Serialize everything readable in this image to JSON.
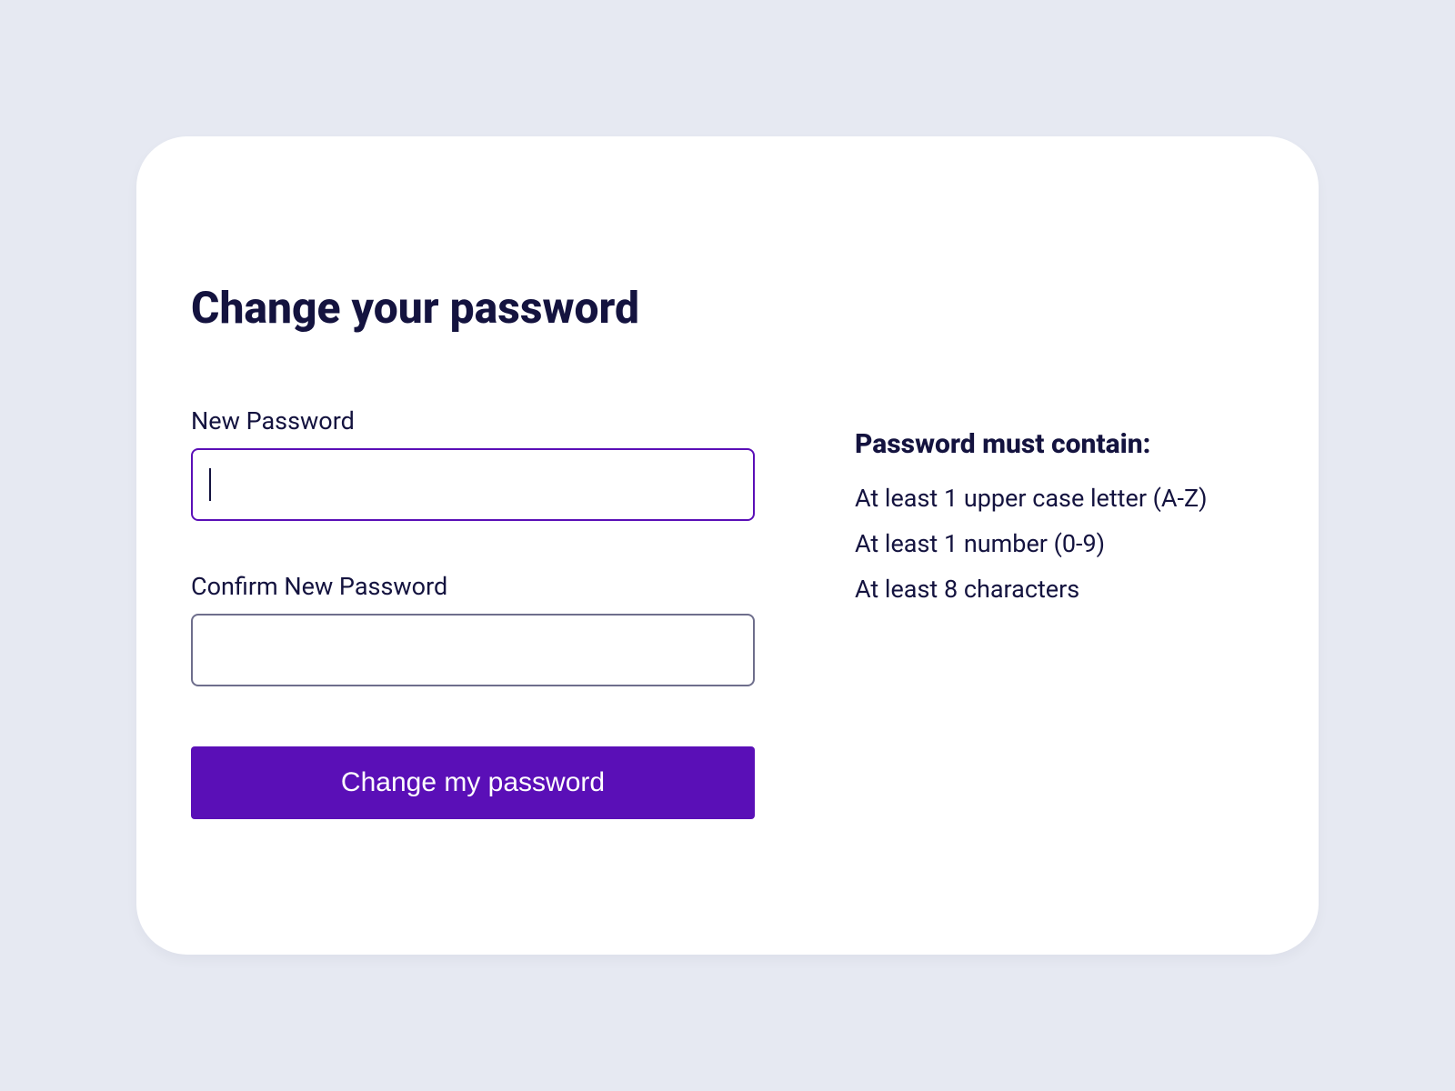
{
  "form": {
    "title": "Change your password",
    "new_password_label": "New Password",
    "new_password_value": "",
    "confirm_password_label": "Confirm New Password",
    "confirm_password_value": "",
    "submit_label": "Change my password"
  },
  "rules": {
    "heading": "Password must contain:",
    "items": [
      "At least 1 upper case letter (A-Z)",
      "At least 1 number (0-9)",
      "At least 8 characters"
    ]
  }
}
